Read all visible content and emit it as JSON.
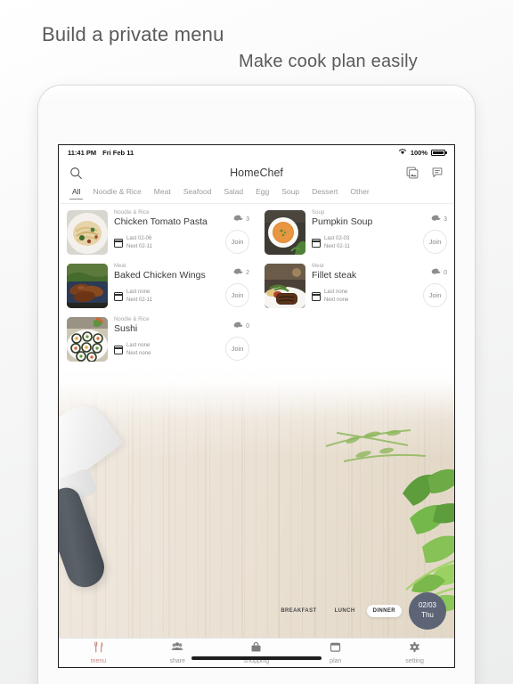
{
  "headline": {
    "line1": "Build a private menu",
    "line2": "Make cook plan easily"
  },
  "statusbar": {
    "time": "11:41 PM",
    "date": "Fri Feb 11",
    "battery_percent": "100%",
    "wifi_icon": "wifi-icon",
    "battery_icon": "battery-icon"
  },
  "navbar": {
    "title": "HomeChef",
    "search_icon": "search-icon",
    "gallery_icon": "gallery-icon",
    "note_icon": "note-add-icon"
  },
  "tabs": [
    {
      "label": "All",
      "active": true
    },
    {
      "label": "Noodle & Rice",
      "active": false
    },
    {
      "label": "Meat",
      "active": false
    },
    {
      "label": "Seafood",
      "active": false
    },
    {
      "label": "Salad",
      "active": false
    },
    {
      "label": "Egg",
      "active": false
    },
    {
      "label": "Soup",
      "active": false
    },
    {
      "label": "Dessert",
      "active": false
    },
    {
      "label": "Other",
      "active": false
    }
  ],
  "cards": [
    {
      "category": "Noodle & Rice",
      "dish": "Chicken Tomato Pasta",
      "last": "Last 02-06",
      "next": "Next 02-11",
      "count": "3",
      "join_label": "Join",
      "thumb": "pasta"
    },
    {
      "category": "Soup",
      "dish": "Pumpkin Soup",
      "last": "Last 02-03",
      "next": "Next 02-11",
      "count": "3",
      "join_label": "Join",
      "thumb": "soup"
    },
    {
      "category": "Meat",
      "dish": "Baked Chicken Wings",
      "last": "Last none",
      "next": "Next 02-11",
      "count": "2",
      "join_label": "Join",
      "thumb": "wings"
    },
    {
      "category": "Meat",
      "dish": "Fillet steak",
      "last": "Last none",
      "next": "Next none",
      "count": "0",
      "join_label": "Join",
      "thumb": "steak"
    },
    {
      "category": "Noodle & Rice",
      "dish": "Sushi",
      "last": "Last none",
      "next": "Next none",
      "count": "0",
      "join_label": "Join",
      "thumb": "sushi"
    }
  ],
  "meal_tags": [
    {
      "label": "BREAKFAST",
      "active": false
    },
    {
      "label": "LUNCH",
      "active": false
    },
    {
      "label": "DINNER",
      "active": true
    }
  ],
  "date_badge": {
    "date": "02/03",
    "weekday": "Thu"
  },
  "tabbar": [
    {
      "label": "menu",
      "icon": "cutlery-icon",
      "active": true
    },
    {
      "label": "share",
      "icon": "people-icon",
      "active": false
    },
    {
      "label": "shopping",
      "icon": "basket-icon",
      "active": false
    },
    {
      "label": "plan",
      "icon": "calendar-icon",
      "active": false
    },
    {
      "label": "setting",
      "icon": "gear-icon",
      "active": false
    }
  ],
  "colors": {
    "accent": "#c98b85",
    "date_badge_bg": "#5d6476",
    "text_primary": "#3a3a3a",
    "text_muted": "#9b9b9b"
  }
}
